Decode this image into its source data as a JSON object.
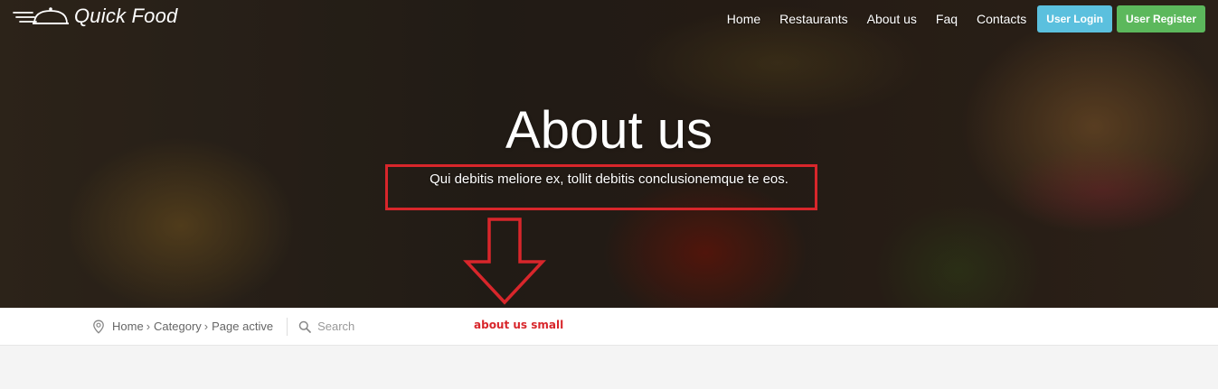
{
  "brand": {
    "name": "Quick Food",
    "icon": "cloche-icon"
  },
  "nav": {
    "links": [
      "Home",
      "Restaurants",
      "About us",
      "Faq",
      "Contacts"
    ],
    "login_label": "User Login",
    "register_label": "User Register"
  },
  "hero": {
    "title": "About us",
    "subtitle": "Qui debitis meliore ex, tollit debitis conclusionemque te eos."
  },
  "breadcrumb": {
    "icon": "location-pin-icon",
    "items": [
      "Home",
      "Category",
      "Page active"
    ],
    "separator": "›"
  },
  "search": {
    "placeholder": "Search",
    "icon": "search-icon"
  },
  "annotation": {
    "label": "about us small",
    "color": "#d8262b"
  },
  "colors": {
    "login": "#5bc0de",
    "register": "#5cb85c",
    "annotation": "#d8262b"
  }
}
